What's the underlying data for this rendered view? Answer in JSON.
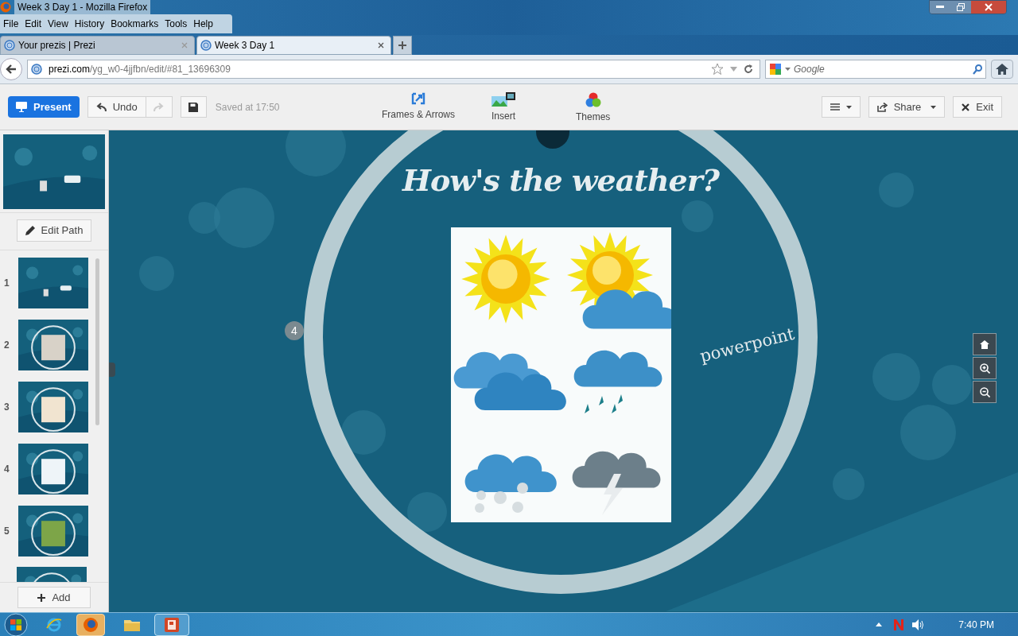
{
  "window": {
    "title": "Week 3 Day 1 - Mozilla Firefox"
  },
  "menu": [
    "File",
    "Edit",
    "View",
    "History",
    "Bookmarks",
    "Tools",
    "Help"
  ],
  "tabs": [
    {
      "label": "Your prezis | Prezi",
      "selected": false
    },
    {
      "label": "Week 3 Day 1",
      "selected": true
    }
  ],
  "address_bar": {
    "host": "prezi.com",
    "path": "/yg_w0-4jjfbn/edit/#81_13696309"
  },
  "search": {
    "placeholder": "Google"
  },
  "toolbar": {
    "present": "Present",
    "undo": "Undo",
    "saved": "Saved at 17:50",
    "tools": [
      {
        "kind": "frames",
        "label": "Frames & Arrows"
      },
      {
        "kind": "insert",
        "label": "Insert"
      },
      {
        "kind": "themes",
        "label": "Themes"
      }
    ],
    "share": "Share",
    "exit": "Exit"
  },
  "sidebar": {
    "edit_path": "Edit Path",
    "add": "Add",
    "slides": [
      {
        "number": "1",
        "selected": false
      },
      {
        "number": "2",
        "selected": false
      },
      {
        "number": "3",
        "selected": false
      },
      {
        "number": "4",
        "selected": false
      },
      {
        "number": "5",
        "selected": false
      }
    ]
  },
  "canvas": {
    "title": "How's the weather?",
    "path_number": "4",
    "label": "powerpoint"
  },
  "taskbar": {
    "clock": "7:40 PM"
  }
}
